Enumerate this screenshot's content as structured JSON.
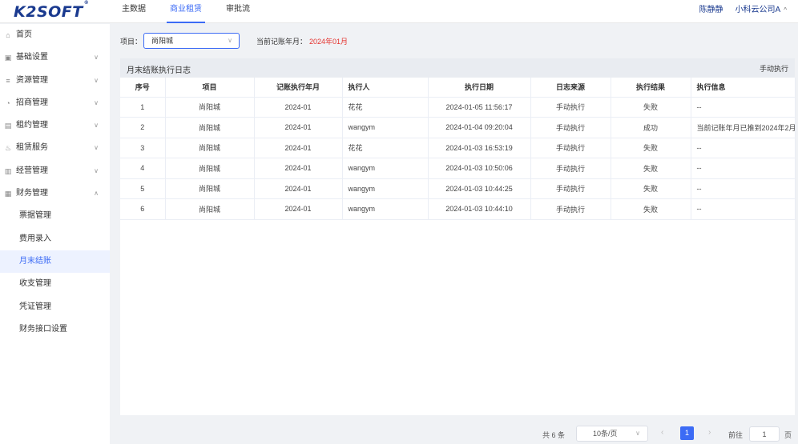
{
  "brand": {
    "logo_text": "K2SOFT",
    "logo_mark": "®"
  },
  "topnav": {
    "items": [
      {
        "label": "主数据",
        "active": false
      },
      {
        "label": "商业租赁",
        "active": true
      },
      {
        "label": "审批流",
        "active": false
      }
    ]
  },
  "user": {
    "name": "陈静静",
    "company": "小科云公司A",
    "caret": "^"
  },
  "sidebar": {
    "items": [
      {
        "label": "首页",
        "icon": "home-icon",
        "glyph": "⌂",
        "expandable": false
      },
      {
        "label": "基础设置",
        "icon": "settings-icon",
        "glyph": "▣",
        "expandable": true,
        "chevron": "∨"
      },
      {
        "label": "资源管理",
        "icon": "resource-icon",
        "glyph": "≡",
        "expandable": true,
        "chevron": "∨"
      },
      {
        "label": "招商管理",
        "icon": "merchant-icon",
        "glyph": "◔",
        "expandable": true,
        "chevron": "∨"
      },
      {
        "label": "租约管理",
        "icon": "lease-icon",
        "glyph": "▤",
        "expandable": true,
        "chevron": "∨"
      },
      {
        "label": "租赁服务",
        "icon": "service-icon",
        "glyph": "♨",
        "expandable": true,
        "chevron": "∨"
      },
      {
        "label": "经营管理",
        "icon": "operation-icon",
        "glyph": "▥",
        "expandable": true,
        "chevron": "∨"
      },
      {
        "label": "财务管理",
        "icon": "finance-icon",
        "glyph": "▦",
        "expandable": true,
        "chevron": "∧"
      }
    ],
    "finance_sub": [
      {
        "label": "票据管理",
        "active": false
      },
      {
        "label": "费用录入",
        "active": false
      },
      {
        "label": "月末结账",
        "active": true
      },
      {
        "label": "收支管理",
        "active": false
      },
      {
        "label": "凭证管理",
        "active": false
      },
      {
        "label": "财务接口设置",
        "active": false
      }
    ]
  },
  "filter": {
    "project_label": "项目：",
    "project_value": "尚阳城",
    "period_label": "当前记账年月：",
    "period_value": "2024年01月"
  },
  "panel": {
    "title": "月末结账执行日志",
    "action": "手动执行"
  },
  "table": {
    "columns": [
      "序号",
      "项目",
      "记账执行年月",
      "执行人",
      "执行日期",
      "日志来源",
      "执行结果",
      "执行信息"
    ],
    "rows": [
      [
        "1",
        "尚阳城",
        "2024-01",
        "花花",
        "2024-01-05 11:56:17",
        "手动执行",
        "失败",
        "--"
      ],
      [
        "2",
        "尚阳城",
        "2024-01",
        "wangym",
        "2024-01-04 09:20:04",
        "手动执行",
        "成功",
        "当前记账年月已推到2024年2月"
      ],
      [
        "3",
        "尚阳城",
        "2024-01",
        "花花",
        "2024-01-03 16:53:19",
        "手动执行",
        "失败",
        "--"
      ],
      [
        "4",
        "尚阳城",
        "2024-01",
        "wangym",
        "2024-01-03 10:50:06",
        "手动执行",
        "失败",
        "--"
      ],
      [
        "5",
        "尚阳城",
        "2024-01",
        "wangym",
        "2024-01-03 10:44:25",
        "手动执行",
        "失败",
        "--"
      ],
      [
        "6",
        "尚阳城",
        "2024-01",
        "wangym",
        "2024-01-03 10:44:10",
        "手动执行",
        "失败",
        "--"
      ]
    ]
  },
  "pagination": {
    "total": "共 6 条",
    "page_size": "10条/页",
    "current_page": "1",
    "goto_label": "前往",
    "goto_value": "1",
    "page_suffix": "页"
  },
  "colors": {
    "accent": "#3c6bf5",
    "brand": "#1a3a8f",
    "highlight": "#e5322d"
  }
}
